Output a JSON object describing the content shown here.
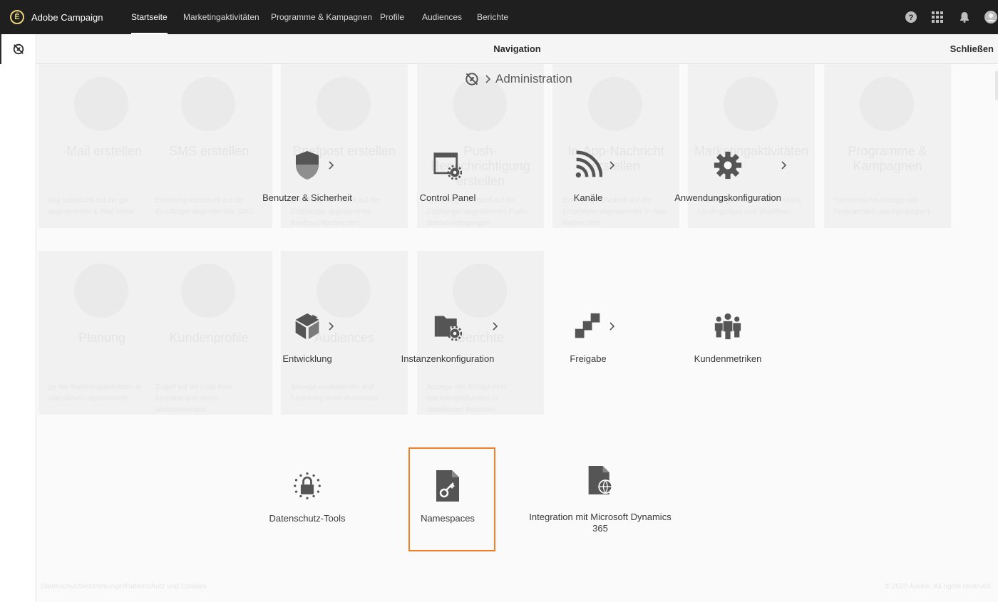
{
  "app": {
    "brand": "Adobe Campaign",
    "logo_glyph": "Ē"
  },
  "topnav": {
    "tabs": [
      "Startseite",
      "Marketingaktivitäten",
      "Programme & Kampagnen",
      "Profile",
      "Audiences",
      "Berichte"
    ],
    "active": "Startseite"
  },
  "header": {
    "title": "Navigation",
    "close_label": "Schließen"
  },
  "breadcrumb": {
    "current": "Administration"
  },
  "background_cards": [
    {
      "title": "-Mail erstellen",
      "desc": "ung individuell auf die ger abgestimmter E-Mail ichten"
    },
    {
      "title": "SMS erstellen",
      "desc": "Erstellung individuell auf die Empfänger abgestimmter SMS"
    },
    {
      "title": "Briefpost erstellen",
      "desc": "Erstellung individuell auf die Empfänger abgestimmter Briefpost-Nachrichten"
    },
    {
      "title": "Push-Benachrichtigung erstellen",
      "desc": "Erstellung individuell auf die Empfänger abgestimmter Push-Benachrichtigungen"
    },
    {
      "title": "In-App-Nachricht erstellen",
      "desc": "Erstellung individuell auf die Empfänger abgestimmter In-App-Nachrichten"
    },
    {
      "title": "Marketingaktivitäten",
      "desc": "Marketingaktivitäten wie E-Mails, Landingpages und Workflows"
    },
    {
      "title": "Programme & Kampagnen",
      "desc": "Hierarchische Anzeige von Programmen und Kampagnen"
    },
    {
      "title": "Planung",
      "desc": "ge der Marketingaktivitäten in interaktiven ngsübersicht"
    },
    {
      "title": "Kundenprofile",
      "desc": "Zugriff auf die Liste Ihrer Kontakte und deren Aktivitätsverlauf"
    },
    {
      "title": "Audiences",
      "desc": "Anzeige existierender und Erstellung neuer Audiences"
    },
    {
      "title": "Berichte",
      "desc": "Anzeige des Erfolgs Ihrer Marketingaktivitäten in detaillierten Berichten"
    }
  ],
  "tiles": [
    {
      "label": "Benutzer & Sicherheit",
      "icon": "shield-icon",
      "has_children": true
    },
    {
      "label": "Control Panel",
      "icon": "control-panel-icon",
      "has_children": false
    },
    {
      "label": "Kanäle",
      "icon": "channels-icon",
      "has_children": true
    },
    {
      "label": "Anwendungskonfiguration",
      "icon": "gear-icon",
      "has_children": true
    },
    {
      "label": "Entwicklung",
      "icon": "cube-icon",
      "has_children": true
    },
    {
      "label": "Instanzenkonfiguration",
      "icon": "folder-gear-icon",
      "has_children": true
    },
    {
      "label": "Freigabe",
      "icon": "deploy-icon",
      "has_children": true
    },
    {
      "label": "Kundenmetriken",
      "icon": "people-icon",
      "has_children": false
    },
    {
      "label": "Datenschutz-Tools",
      "icon": "privacy-lock-icon",
      "has_children": false
    },
    {
      "label": "Namespaces",
      "icon": "key-document-icon",
      "has_children": false,
      "highlighted": true
    },
    {
      "label": "Integration mit Microsoft Dynamics 365",
      "icon": "globe-document-icon",
      "has_children": false
    }
  ],
  "footer": {
    "links": [
      "Datenschutzbestimmungen",
      "Datenschutz und Cookies"
    ],
    "copyright": "© 2020 Adobe. All rights reserved."
  },
  "colors": {
    "topbar": "#1f1f1f",
    "highlight": "#f48024",
    "icon": "#555555"
  }
}
